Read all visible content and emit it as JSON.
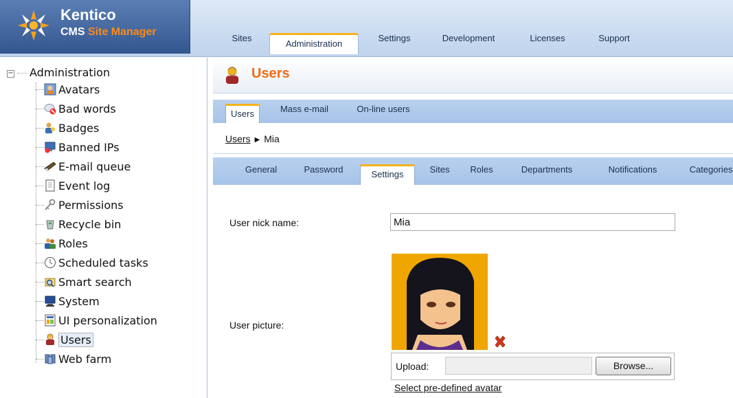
{
  "brand": {
    "name": "Kentico",
    "subtitle_pre": "CMS ",
    "subtitle_highlight": "Site Manager",
    "accent": "#ff8a17"
  },
  "main_tabs": [
    {
      "label": "Sites",
      "active": false
    },
    {
      "label": "Administration",
      "active": true
    },
    {
      "label": "Settings",
      "active": false
    },
    {
      "label": "Development",
      "active": false
    },
    {
      "label": "Licenses",
      "active": false
    },
    {
      "label": "Support",
      "active": false
    }
  ],
  "tree": {
    "root_label": "Administration",
    "items": [
      {
        "label": "Avatars",
        "icon": "avatar-icon"
      },
      {
        "label": "Bad words",
        "icon": "bad-words-icon"
      },
      {
        "label": "Badges",
        "icon": "badges-icon"
      },
      {
        "label": "Banned IPs",
        "icon": "banned-ips-icon"
      },
      {
        "label": "E-mail queue",
        "icon": "email-queue-icon"
      },
      {
        "label": "Event log",
        "icon": "event-log-icon"
      },
      {
        "label": "Permissions",
        "icon": "permissions-icon"
      },
      {
        "label": "Recycle bin",
        "icon": "recycle-bin-icon"
      },
      {
        "label": "Roles",
        "icon": "roles-icon"
      },
      {
        "label": "Scheduled tasks",
        "icon": "clock-icon"
      },
      {
        "label": "Smart search",
        "icon": "smart-search-icon"
      },
      {
        "label": "System",
        "icon": "system-icon"
      },
      {
        "label": "UI personalization",
        "icon": "ui-personalization-icon"
      },
      {
        "label": "Users",
        "icon": "users-icon",
        "selected": true
      },
      {
        "label": "Web farm",
        "icon": "web-farm-icon"
      }
    ]
  },
  "page": {
    "title": "Users",
    "title_color": "#f06b12"
  },
  "sub_tabs": [
    {
      "label": "Users",
      "active": true
    },
    {
      "label": "Mass e-mail",
      "active": false
    },
    {
      "label": "On-line users",
      "active": false
    }
  ],
  "breadcrumb": {
    "parent": "Users",
    "current": "Mia"
  },
  "user_tabs": [
    {
      "label": "General",
      "active": false
    },
    {
      "label": "Password",
      "active": false
    },
    {
      "label": "Settings",
      "active": true
    },
    {
      "label": "Sites",
      "active": false
    },
    {
      "label": "Roles",
      "active": false
    },
    {
      "label": "Departments",
      "active": false
    },
    {
      "label": "Notifications",
      "active": false
    },
    {
      "label": "Categories",
      "active": false
    }
  ],
  "form": {
    "nick_label": "User nick name:",
    "nick_value": "Mia",
    "picture_label": "User picture:",
    "upload_label": "Upload:",
    "browse_label": "Browse...",
    "avatar_link": "Select pre-defined avatar"
  }
}
